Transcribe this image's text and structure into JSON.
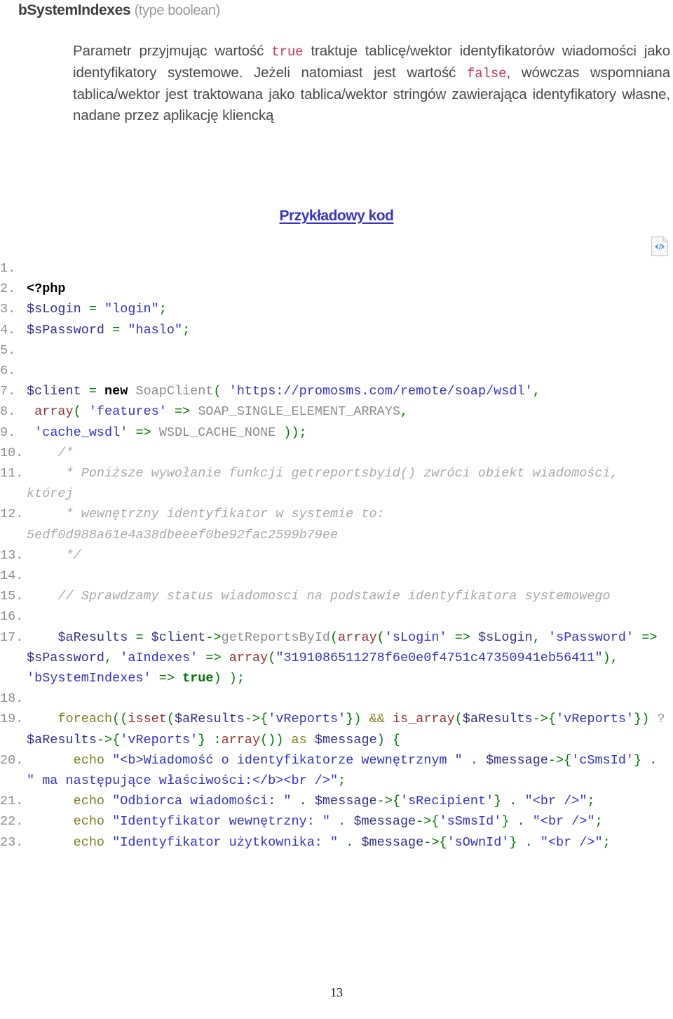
{
  "param": {
    "name": "bSystemIndexes",
    "type_label": "(type boolean)"
  },
  "description": {
    "part1": "Parametr przyjmując wartość ",
    "kw_true": "true",
    "part2": " traktuje tablicę/wektor identyfikatorów wiadomości jako identyfikatory systemowe. Jeżeli natomiast jest wartość ",
    "kw_false": "false",
    "part3": ", wówczas wspomniana tablica/wektor jest traktowana jako tablica/wektor stringów zawierająca identyfikatory własne, nadane przez aplikację kliencką"
  },
  "section": {
    "heading": "Przykładowy kod",
    "icon": "code-file-icon"
  },
  "code": {
    "language": "php",
    "lines": [
      {
        "n": "1.",
        "text": ""
      },
      {
        "n": "2.",
        "text": "<?php"
      },
      {
        "n": "3.",
        "text": "$sLogin = \"login\";"
      },
      {
        "n": "4.",
        "text": "$sPassword = \"haslo\";"
      },
      {
        "n": "5.",
        "text": ""
      },
      {
        "n": "6.",
        "text": ""
      },
      {
        "n": "7.",
        "text": "$client = new SoapClient( 'https://promosms.com/remote/soap/wsdl',"
      },
      {
        "n": "8.",
        "text": " array( 'features' => SOAP_SINGLE_ELEMENT_ARRAYS,"
      },
      {
        "n": "9.",
        "text": " 'cache_wsdl' => WSDL_CACHE_NONE ));"
      },
      {
        "n": "10.",
        "text": "    /*"
      },
      {
        "n": "11.",
        "text": "     * Poniższe wywołanie funkcji getreportsbyid() zwróci obiekt wiadomości, której"
      },
      {
        "n": "12.",
        "text": "     * wewnętrzny identyfikator w systemie to: 5edf0d988a61e4a38dbeeef0be92fac2599b79ee"
      },
      {
        "n": "13.",
        "text": "     */"
      },
      {
        "n": "14.",
        "text": ""
      },
      {
        "n": "15.",
        "text": "    // Sprawdzamy status wiadomosci na podstawie identyfikatora systemowego"
      },
      {
        "n": "16.",
        "text": ""
      },
      {
        "n": "17.",
        "text": "    $aResults = $client->getReportsById(array('sLogin' => $sLogin, 'sPassword' => $sPassword, 'aIndexes' => array(\"3191086511278f6e0e0f4751c47350941eb56411\"), 'bSystemIndexes' => true) );"
      },
      {
        "n": "18.",
        "text": ""
      },
      {
        "n": "19.",
        "text": "    foreach((isset($aResults->{'vReports'}) && is_array($aResults->{'vReports'}) ? $aResults->{'vReports'} :array()) as $message) {"
      },
      {
        "n": "20.",
        "text": "      echo \"<b>Wiadomość o identyfikatorze wewnętrznym \" . $message->{'cSmsId'} . \" ma następujące właściwości:</b><br />\";"
      },
      {
        "n": "21.",
        "text": "      echo \"Odbiorca wiadomości: \" . $message->{'sRecipient'} . \"<br />\";"
      },
      {
        "n": "22.",
        "text": "      echo \"Identyfikator wewnętrzny: \" . $message->{'sSmsId'} . \"<br />\";"
      },
      {
        "n": "23.",
        "text": "      echo \"Identyfikator użytkownika: \" . $message->{'sOwnId'} . \"<br />\";"
      }
    ],
    "identifiers": {
      "internal_id_comment": "5edf0d988a61e4a38dbeeef0be92fac2599b79ee",
      "index_value": "3191086511278f6e0e0f4751c47350941eb56411",
      "wsdl_url": "https://promosms.com/remote/soap/wsdl",
      "login_value": "login",
      "password_value": "haslo"
    }
  },
  "footer": {
    "page_number": "13"
  },
  "colors": {
    "keyword_red": "#d2325c",
    "link_blue": "#3b33c9",
    "string_blue": "#3333cc",
    "variable_blue": "#31318f",
    "operator_green": "#007700",
    "function_maroon": "#993333",
    "control_olive": "#807f20",
    "comment_gray": "#aaaaaa",
    "body_gray": "#4a4a4a"
  }
}
